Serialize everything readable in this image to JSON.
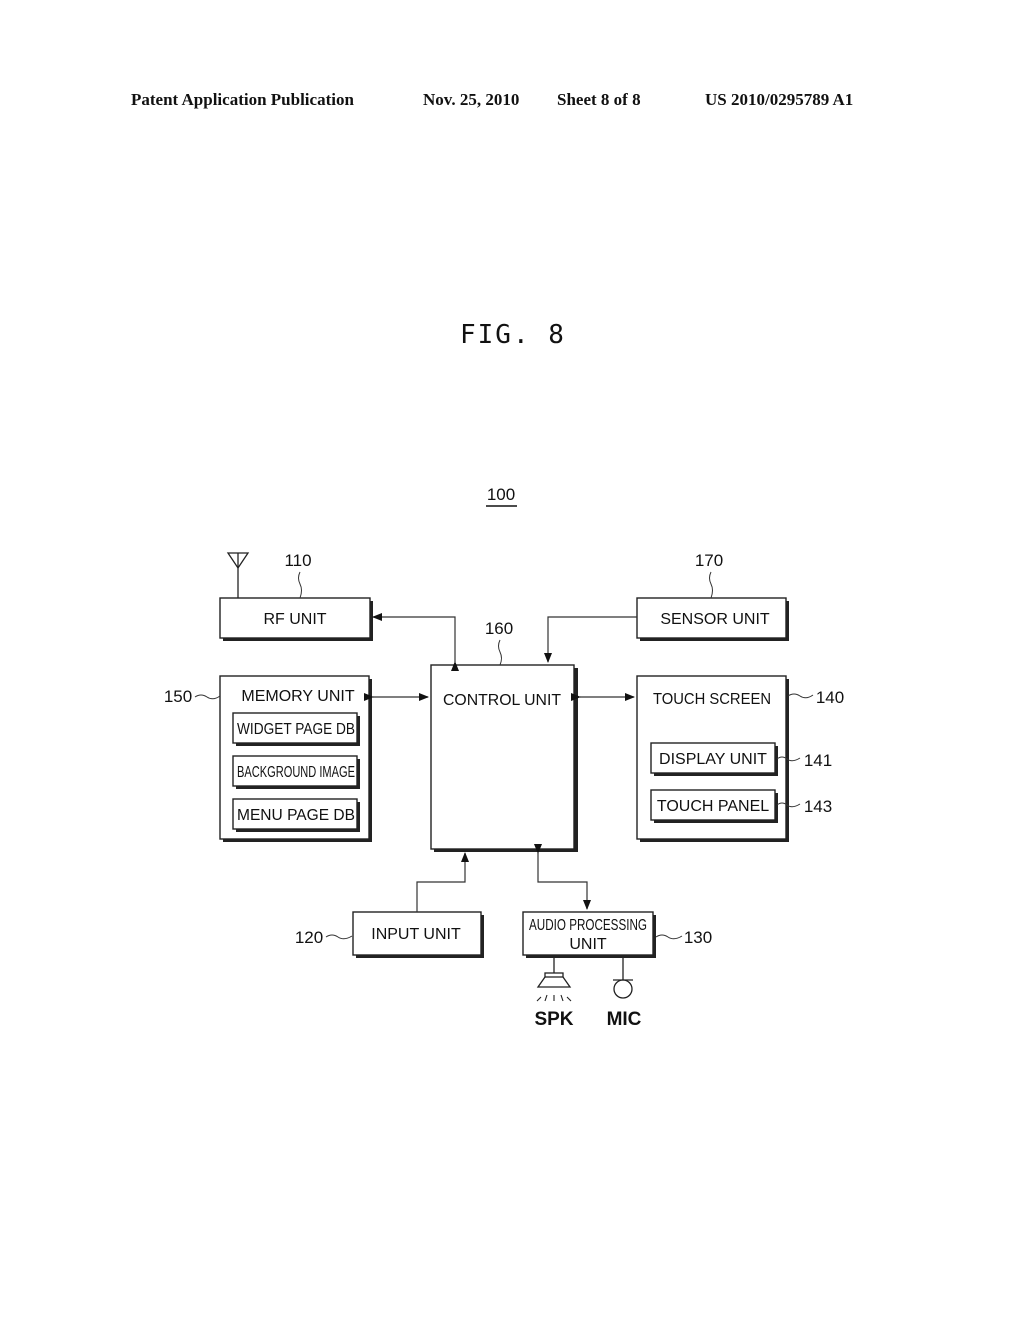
{
  "header": {
    "publication": "Patent Application Publication",
    "date": "Nov. 25, 2010",
    "sheet": "Sheet 8 of 8",
    "number": "US 2010/0295789 A1"
  },
  "figure": {
    "title": "FIG. 8",
    "ref_system": "100"
  },
  "blocks": {
    "rf_unit": {
      "label": "RF UNIT",
      "ref": "110"
    },
    "sensor_unit": {
      "label": "SENSOR UNIT",
      "ref": "170"
    },
    "control_unit": {
      "label": "CONTROL UNIT",
      "ref": "160"
    },
    "memory_unit": {
      "label": "MEMORY UNIT",
      "ref": "150",
      "items": [
        "WIDGET PAGE DB",
        "BACKGROUND IMAGE",
        "MENU PAGE DB"
      ]
    },
    "touch_screen": {
      "label": "TOUCH SCREEN",
      "ref": "140",
      "display_unit": {
        "label": "DISPLAY UNIT",
        "ref": "141"
      },
      "touch_panel": {
        "label": "TOUCH PANEL",
        "ref": "143"
      }
    },
    "input_unit": {
      "label": "INPUT UNIT",
      "ref": "120"
    },
    "audio_unit": {
      "label_line1": "AUDIO PROCESSING",
      "label_line2": "UNIT",
      "ref": "130"
    },
    "speaker": {
      "label": "SPK"
    },
    "mic": {
      "label": "MIC"
    }
  }
}
